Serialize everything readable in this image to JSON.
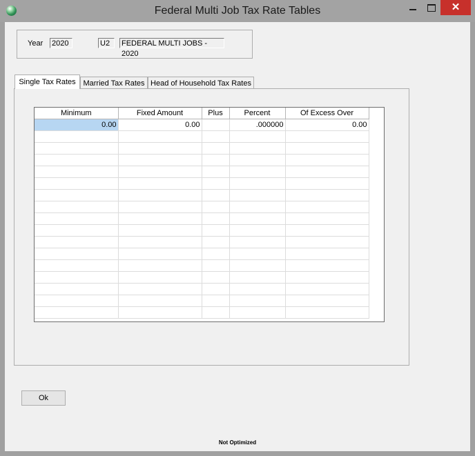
{
  "window": {
    "title": "Federal Multi Job Tax Rate Tables",
    "close_glyph": "✕"
  },
  "header": {
    "year_label": "Year",
    "year_value": "2020",
    "code_value": "U2",
    "description_value": "FEDERAL MULTI JOBS - 2020"
  },
  "tabs": [
    {
      "label": "Single Tax Rates",
      "active": true
    },
    {
      "label": "Married Tax Rates",
      "active": false
    },
    {
      "label": "Head of Household Tax Rates",
      "active": false
    }
  ],
  "table": {
    "columns": [
      "Minimum",
      "Fixed Amount",
      "Plus",
      "Percent",
      "Of Excess Over"
    ],
    "rows": [
      [
        "0.00",
        "0.00",
        "",
        ".000000",
        "0.00"
      ]
    ],
    "empty_rows": 16
  },
  "buttons": {
    "ok_label": "Ok"
  },
  "status": {
    "text": "Not Optimized"
  },
  "colors": {
    "selected_cell": "#b7d6f2",
    "close_button": "#c7302b"
  }
}
